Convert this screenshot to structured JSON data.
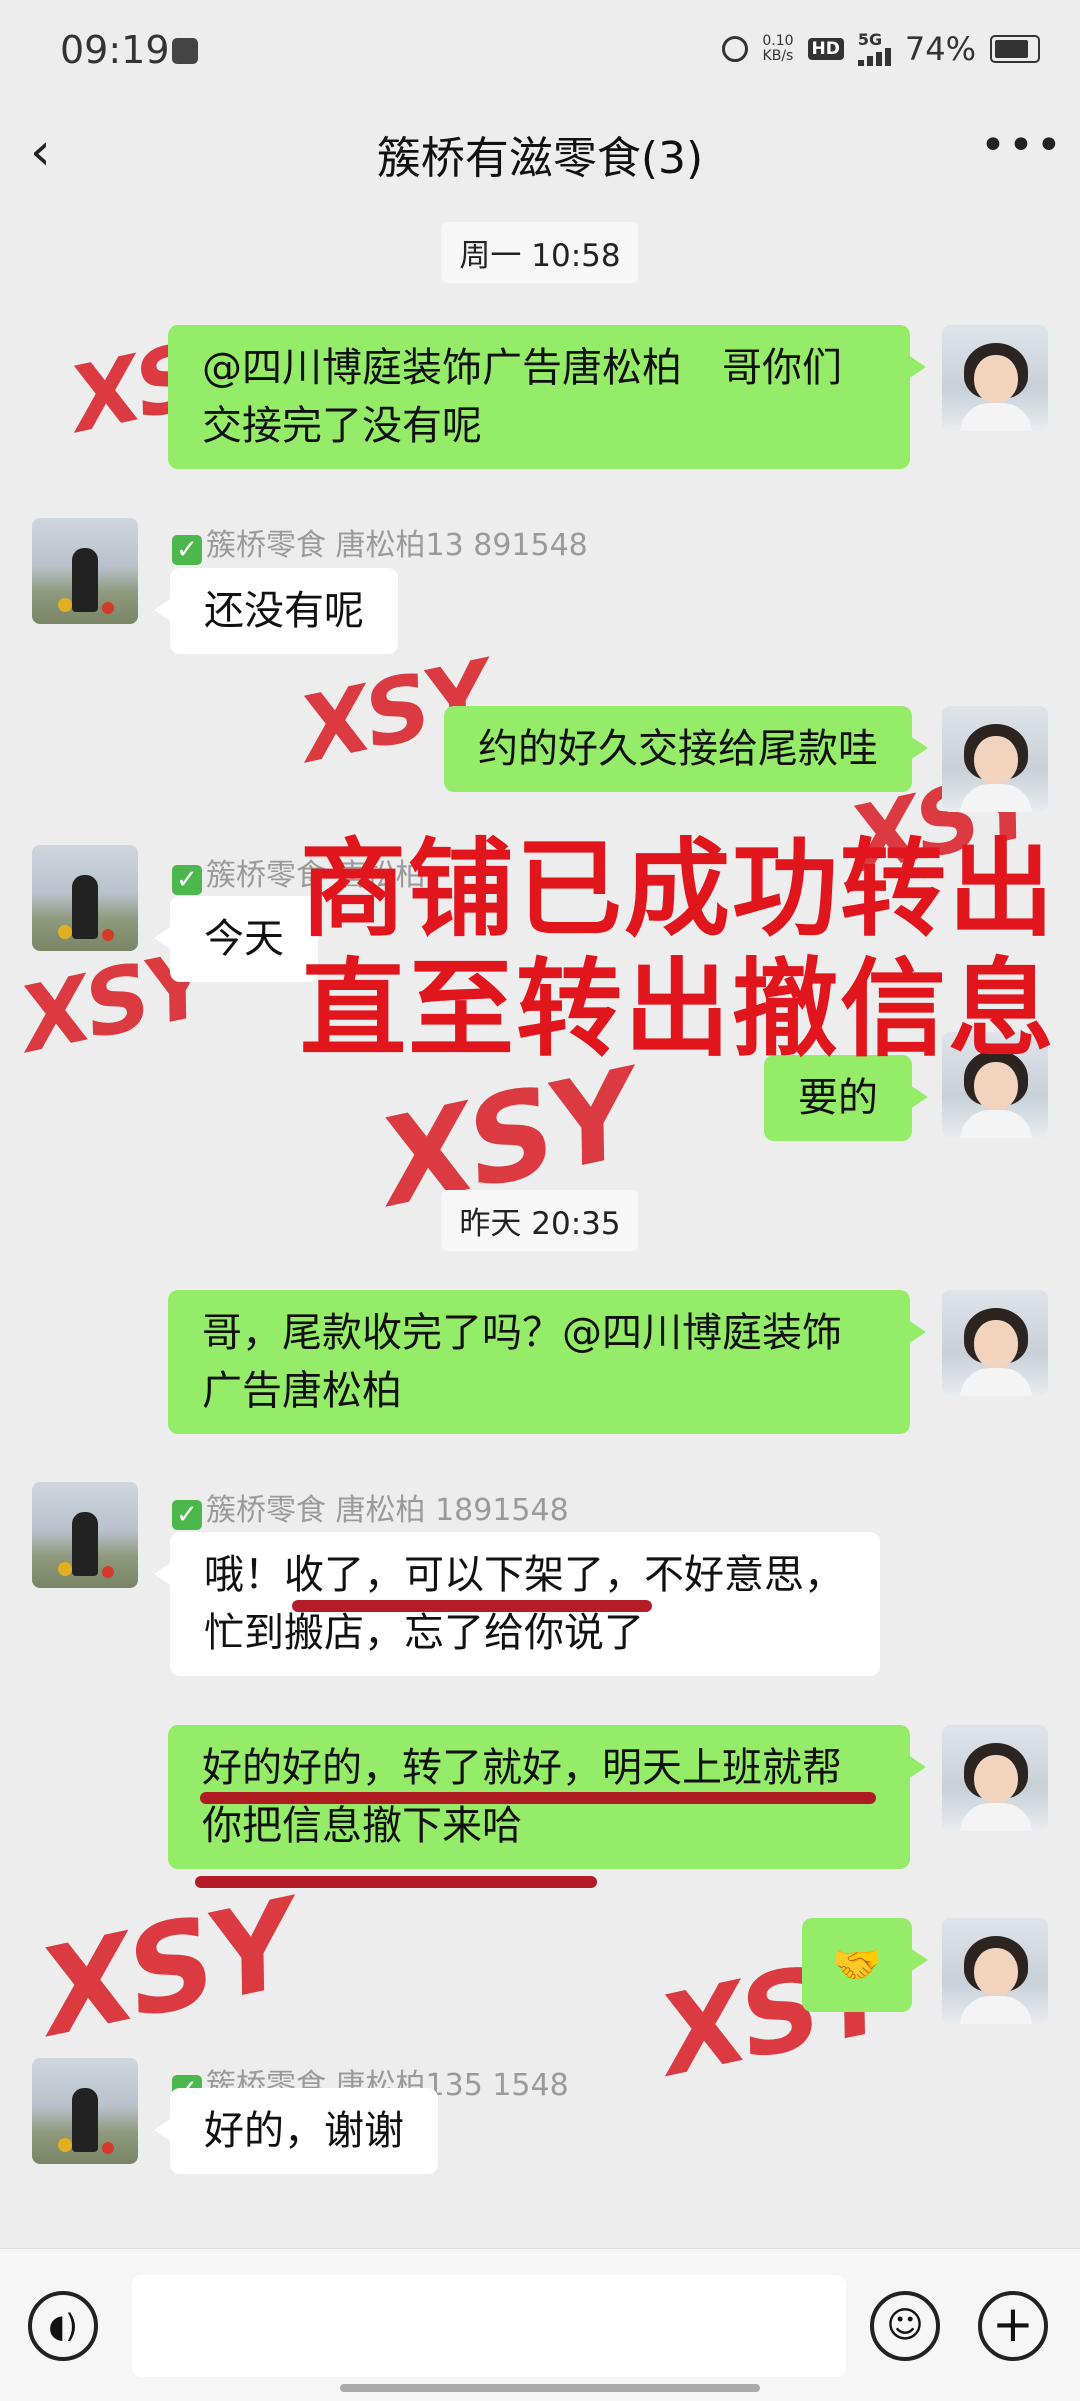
{
  "status_bar": {
    "time": "09:19",
    "net_speed_value": "0.10",
    "net_speed_unit": "KB/s",
    "hd": "HD",
    "signal": "5G",
    "battery": "74%"
  },
  "header": {
    "back_icon": "chevron-left-icon",
    "title": "簇桥有滋零食(3)",
    "more_icon": "more-dots-icon"
  },
  "timestamps": [
    "周一 10:58",
    "昨天 20:35"
  ],
  "messages": [
    {
      "side": "me",
      "text": "@四川博庭装饰广告唐松柏　哥你们交接完了没有呢"
    },
    {
      "side": "other",
      "sender": "簇桥零食 唐松柏13 891548",
      "text": "还没有呢"
    },
    {
      "side": "me",
      "text": "约的好久交接给尾款哇"
    },
    {
      "side": "other",
      "sender": "簇桥零食 唐松柏",
      "text": "今天"
    },
    {
      "side": "me",
      "text": "要的"
    },
    {
      "side": "me",
      "text": "哥，尾款收完了吗？@四川博庭装饰广告唐松柏"
    },
    {
      "side": "other",
      "sender": "簇桥零食 唐松柏 1891548",
      "text": "哦！收了，可以下架了，不好意思，忙到搬店，忘了给你说了"
    },
    {
      "side": "me",
      "text": "好的好的，转了就好，明天上班就帮你把信息撤下来哈"
    },
    {
      "side": "me",
      "text": "🤝"
    },
    {
      "side": "other",
      "sender": "簇桥零食 唐松柏135 1548",
      "text": "好的，谢谢"
    }
  ],
  "overlay": {
    "line1": "商铺已成功转出",
    "line2": "直至转出撤信息",
    "color": "#e0161c"
  },
  "watermark": "XSY",
  "colors": {
    "my_bubble": "#95ec69",
    "their_bubble": "#ffffff",
    "background": "#ededed",
    "underline": "#b0101e"
  },
  "bottom_bar": {
    "voice_icon": "voice-icon",
    "emoji_icon": "emoji-icon",
    "plus_icon": "plus-icon",
    "input_value": ""
  }
}
